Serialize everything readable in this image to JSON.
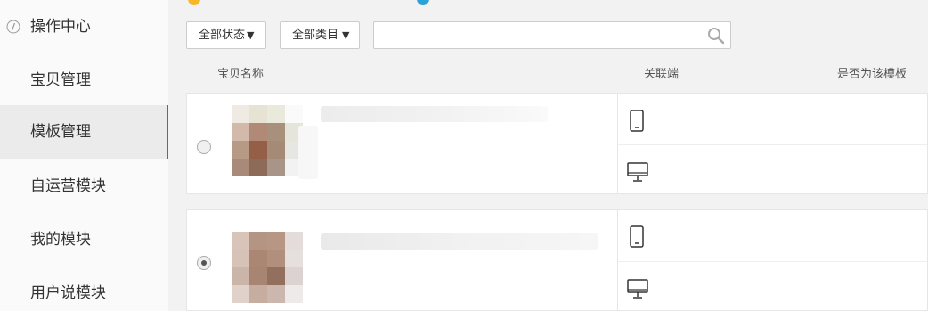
{
  "sidebar": {
    "items": [
      {
        "label": "操作中心",
        "icon": "info-icon"
      },
      {
        "label": "宝贝管理"
      },
      {
        "label": "模板管理",
        "active": true
      },
      {
        "label": "自运营模块"
      },
      {
        "label": "我的模块"
      },
      {
        "label": "用户说模块"
      }
    ],
    "accent": "#e0333d"
  },
  "filters": {
    "status_label": "全部状态",
    "category_label": "全部类目",
    "search_value": "",
    "search_placeholder": ""
  },
  "table": {
    "headers": {
      "name": "宝贝名称",
      "linked": "关联端",
      "is_template": "是否为该模板"
    },
    "rows": [
      {
        "selected": false,
        "devices": [
          "mobile-icon",
          "desktop-icon"
        ]
      },
      {
        "selected": true,
        "devices": [
          "mobile-icon",
          "desktop-icon"
        ]
      }
    ]
  }
}
